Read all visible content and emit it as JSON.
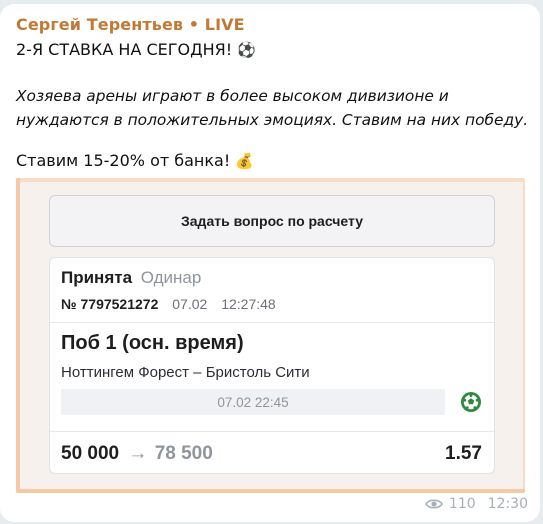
{
  "message": {
    "author": "Сергей Терентьев • LIVE",
    "headline": "2-Я СТАВКА НА СЕГОДНЯ!",
    "headline_emoji": "⚽",
    "body": "Хозяева арены играют в более высоком дивизионе и нуждаются в положительных эмоциях. Ставим на них победу.",
    "stake_text": "Ставим 15-20% от банка!",
    "stake_emoji": "💰",
    "views": "110",
    "time": "12:30"
  },
  "bet": {
    "ask_button_label": "Задать вопрос по расчету",
    "status": "Принята",
    "type": "Одинар",
    "number_prefix": "№",
    "number": "7797521272",
    "date": "07.02",
    "time": "12:27:48",
    "outcome": "Поб 1 (осн. время)",
    "match": "Ноттингем Форест – Бристоль Сити",
    "event_datetime": "07.02 22:45",
    "stake": "50 000",
    "arrow": "→",
    "payout": "78 500",
    "odds": "1.57"
  },
  "icons": {
    "ball": "soccer-ball-icon",
    "views": "eye-icon"
  },
  "colors": {
    "author": "#c07a34",
    "accent": "#f4c9a4",
    "ball": "#2e8b3d"
  }
}
